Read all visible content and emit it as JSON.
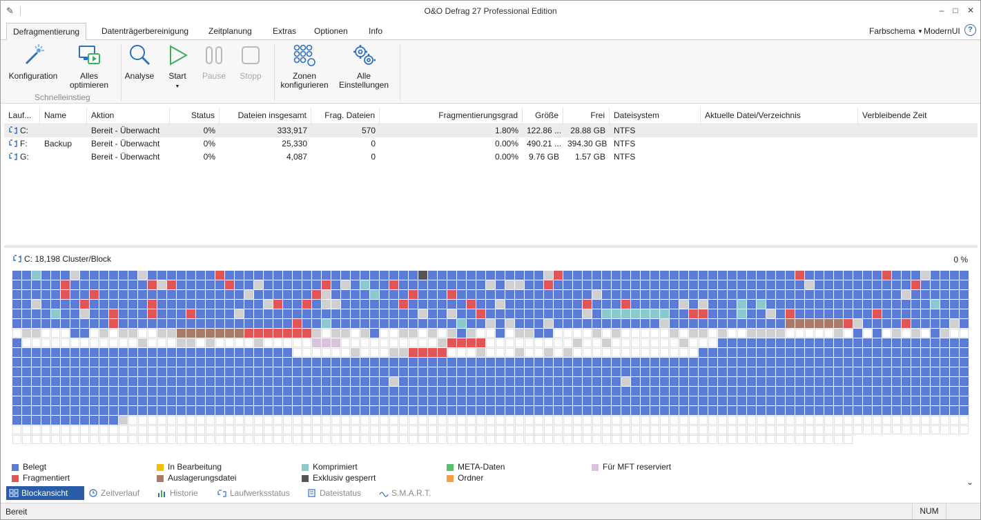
{
  "window": {
    "title": "O&O Defrag 27 Professional Edition",
    "minimize": "–",
    "maximize": "□",
    "close": "✕"
  },
  "tabs": [
    {
      "label": "Defragmentierung",
      "active": true
    },
    {
      "label": "Datenträgerbereinigung"
    },
    {
      "label": "Zeitplanung"
    },
    {
      "label": "Extras"
    },
    {
      "label": "Optionen"
    },
    {
      "label": "Info"
    }
  ],
  "scheme": {
    "label": "Farbschema",
    "value": "ModernUI"
  },
  "ribbon": {
    "buttons": [
      {
        "label": "Konfiguration",
        "icon": "wand-icon"
      },
      {
        "label": "Alles optimieren",
        "icon": "monitor-play-icon"
      },
      {
        "label": "Analyse",
        "icon": "magnifier-icon"
      },
      {
        "label": "Start",
        "icon": "play-icon"
      },
      {
        "label": "Pause",
        "icon": "pause-icon",
        "disabled": true
      },
      {
        "label": "Stopp",
        "icon": "stop-icon",
        "disabled": true
      },
      {
        "label": "Zonen konfigurieren",
        "icon": "zones-icon"
      },
      {
        "label": "Alle Einstellungen",
        "icon": "gears-icon"
      }
    ],
    "group_label": "Schnelleinstieg"
  },
  "table": {
    "headers": [
      "Lauf...",
      "Name",
      "Aktion",
      "Status",
      "Dateien insgesamt",
      "Frag. Dateien",
      "Fragmentierungsgrad",
      "Größe",
      "Frei",
      "Dateisystem",
      "Aktuelle Datei/Verzeichnis",
      "Verbleibende Zeit"
    ],
    "rows": [
      {
        "drive": "C:",
        "name": "",
        "action": "Bereit - Überwacht",
        "status": "0%",
        "files": "333,917",
        "frag": "570",
        "degree": "1.80%",
        "size": "122.86 ...",
        "free": "28.88 GB",
        "fs": "NTFS",
        "current": "",
        "remaining": "",
        "selected": true
      },
      {
        "drive": "F:",
        "name": "Backup",
        "action": "Bereit - Überwacht",
        "status": "0%",
        "files": "25,330",
        "frag": "0",
        "degree": "0.00%",
        "size": "490.21 ...",
        "free": "394.30 GB",
        "fs": "NTFS",
        "current": "",
        "remaining": ""
      },
      {
        "drive": "G:",
        "name": "",
        "action": "Bereit - Überwacht",
        "status": "0%",
        "files": "4,087",
        "frag": "0",
        "degree": "0.00%",
        "size": "9.76 GB",
        "free": "1.57 GB",
        "fs": "NTFS",
        "current": "",
        "remaining": ""
      }
    ]
  },
  "map": {
    "header": "C: 18,198 Cluster/Block",
    "percent": "0 %"
  },
  "colors": {
    "belegt": "#5b7bd5",
    "fragmentiert": "#e05555",
    "in_bearbeitung": "#f0c000",
    "auslagerung": "#a87a6a",
    "komprimiert": "#8cc9cf",
    "exklusiv": "#555555",
    "meta": "#55c06a",
    "ordner": "#f5a040",
    "mft": "#d9c3dc",
    "frei": "#ffffff",
    "grau": "#d0d0d0",
    "accent": "#2a5da8"
  },
  "legend": [
    {
      "label": "Belegt",
      "color": "#5b7bd5"
    },
    {
      "label": "Fragmentiert",
      "color": "#e05555"
    },
    {
      "label": "In Bearbeitung",
      "color": "#f0c000"
    },
    {
      "label": "Auslagerungsdatei",
      "color": "#a87a6a"
    },
    {
      "label": "Komprimiert",
      "color": "#8cc9cf"
    },
    {
      "label": "Exklusiv gesperrt",
      "color": "#555555"
    },
    {
      "label": "META-Daten",
      "color": "#55c06a"
    },
    {
      "label": "Ordner",
      "color": "#f5a040"
    },
    {
      "label": "Für MFT reserviert",
      "color": "#d9c3dc"
    }
  ],
  "viewtabs": [
    {
      "label": "Blockansicht",
      "active": true
    },
    {
      "label": "Zeitverlauf"
    },
    {
      "label": "Historie"
    },
    {
      "label": "Laufwerksstatus"
    },
    {
      "label": "Dateistatus"
    },
    {
      "label": "S.M.A.R.T."
    }
  ],
  "status": {
    "text": "Bereit",
    "num": "NUM"
  }
}
